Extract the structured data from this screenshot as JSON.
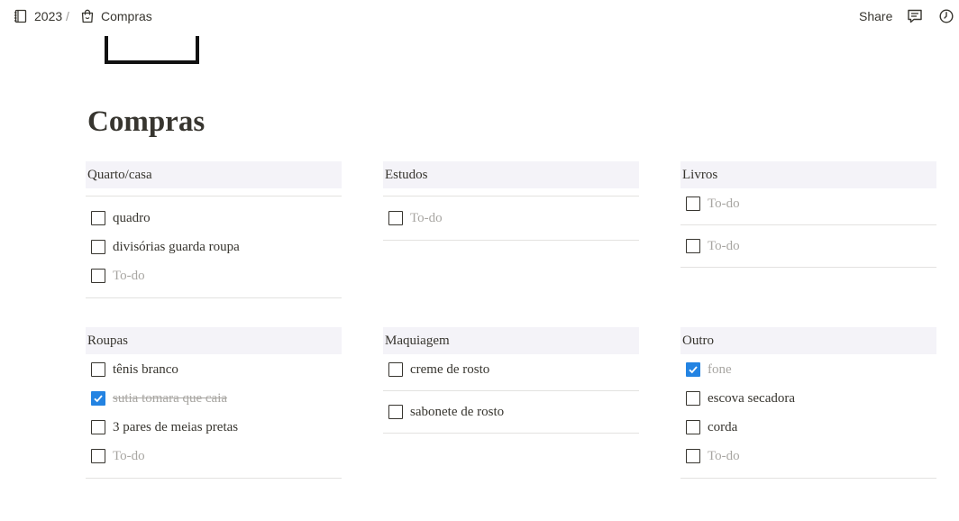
{
  "topbar": {
    "breadcrumb_year": "2023",
    "breadcrumb_sep": "/",
    "breadcrumb_page": "Compras",
    "share_label": "Share"
  },
  "page": {
    "title": "Compras"
  },
  "blocks": [
    {
      "header": "Quarto/casa",
      "items": [
        {
          "label": "quadro",
          "state": "unchecked"
        },
        {
          "label": "divisórias guarda roupa",
          "state": "unchecked"
        },
        {
          "label": "To-do",
          "state": "placeholder"
        }
      ]
    },
    {
      "header": "Estudos",
      "items": [
        {
          "label": "To-do",
          "state": "placeholder"
        }
      ]
    },
    {
      "header": "Livros",
      "items": [
        {
          "label": "To-do",
          "state": "placeholder"
        },
        {
          "label": "To-do",
          "state": "placeholder"
        }
      ]
    },
    {
      "header": "Roupas",
      "items": [
        {
          "label": "tênis branco",
          "state": "unchecked"
        },
        {
          "label": "sutia tomara que caia",
          "state": "checked"
        },
        {
          "label": "3 pares de meias pretas",
          "state": "unchecked"
        },
        {
          "label": "To-do",
          "state": "placeholder"
        }
      ]
    },
    {
      "header": "Maquiagem",
      "items": [
        {
          "label": "creme de rosto",
          "state": "unchecked"
        },
        {
          "label": "sabonete de rosto",
          "state": "unchecked"
        }
      ]
    },
    {
      "header": "Outro",
      "items": [
        {
          "label": "fone",
          "state": "checked"
        },
        {
          "label": "escova secadora",
          "state": "unchecked"
        },
        {
          "label": "corda",
          "state": "unchecked"
        },
        {
          "label": "To-do",
          "state": "placeholder"
        }
      ]
    }
  ],
  "colors": {
    "checkbox_checked": "#2383e2",
    "header_bg": "#f4f3f8",
    "text": "#37352f",
    "placeholder": "#a8a6a2"
  }
}
